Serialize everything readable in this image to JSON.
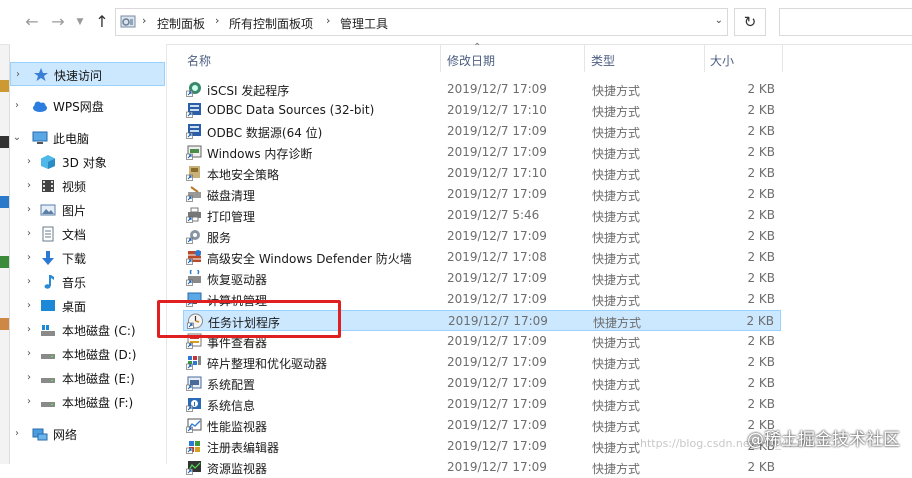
{
  "address_bar": {
    "breadcrumbs": [
      "控制面板",
      "所有控制面板项",
      "管理工具"
    ]
  },
  "sidebar": {
    "items": [
      {
        "label": "快速访问",
        "icon": "star-pin-icon",
        "selected": true
      },
      {
        "label": "WPS网盘",
        "icon": "cloud-icon"
      },
      {
        "label": "此电脑",
        "icon": "computer-icon",
        "expanded": true
      },
      {
        "label": "3D 对象",
        "icon": "cube-3d-icon"
      },
      {
        "label": "视频",
        "icon": "video-icon"
      },
      {
        "label": "图片",
        "icon": "picture-icon"
      },
      {
        "label": "文档",
        "icon": "document-icon"
      },
      {
        "label": "下载",
        "icon": "download-arrow-icon"
      },
      {
        "label": "音乐",
        "icon": "music-note-icon"
      },
      {
        "label": "桌面",
        "icon": "desktop-icon"
      },
      {
        "label": "本地磁盘 (C:)",
        "icon": "windows-drive-icon"
      },
      {
        "label": "本地磁盘 (D:)",
        "icon": "drive-icon"
      },
      {
        "label": "本地磁盘 (E:)",
        "icon": "drive-icon"
      },
      {
        "label": "本地磁盘 (F:)",
        "icon": "drive-icon"
      },
      {
        "label": "网络",
        "icon": "network-icon"
      }
    ]
  },
  "columns": {
    "name": "名称",
    "date": "修改日期",
    "type": "类型",
    "size": "大小"
  },
  "files": [
    {
      "name": "iSCSI 发起程序",
      "date": "2019/12/7 17:09",
      "type": "快捷方式",
      "size": "2 KB",
      "icon": "iscsi-icon"
    },
    {
      "name": "ODBC Data Sources (32-bit)",
      "date": "2019/12/7 17:10",
      "type": "快捷方式",
      "size": "2 KB",
      "icon": "odbc-icon"
    },
    {
      "name": "ODBC 数据源(64 位)",
      "date": "2019/12/7 17:09",
      "type": "快捷方式",
      "size": "2 KB",
      "icon": "odbc-icon"
    },
    {
      "name": "Windows 内存诊断",
      "date": "2019/12/7 17:09",
      "type": "快捷方式",
      "size": "2 KB",
      "icon": "memory-diagnostic-icon"
    },
    {
      "name": "本地安全策略",
      "date": "2019/12/7 17:10",
      "type": "快捷方式",
      "size": "2 KB",
      "icon": "security-policy-icon"
    },
    {
      "name": "磁盘清理",
      "date": "2019/12/7 17:09",
      "type": "快捷方式",
      "size": "2 KB",
      "icon": "disk-cleanup-icon"
    },
    {
      "name": "打印管理",
      "date": "2019/12/7 5:46",
      "type": "快捷方式",
      "size": "2 KB",
      "icon": "printer-icon"
    },
    {
      "name": "服务",
      "date": "2019/12/7 17:09",
      "type": "快捷方式",
      "size": "2 KB",
      "icon": "services-gear-icon"
    },
    {
      "name": "高级安全 Windows Defender 防火墙",
      "date": "2019/12/7 17:08",
      "type": "快捷方式",
      "size": "2 KB",
      "icon": "firewall-icon"
    },
    {
      "name": "恢复驱动器",
      "date": "2019/12/7 17:09",
      "type": "快捷方式",
      "size": "2 KB",
      "icon": "recovery-drive-icon"
    },
    {
      "name": "计算机管理",
      "date": "2019/12/7 17:09",
      "type": "快捷方式",
      "size": "2 KB",
      "icon": "computer-management-icon"
    },
    {
      "name": "任务计划程序",
      "date": "2019/12/7 17:09",
      "type": "快捷方式",
      "size": "2 KB",
      "icon": "task-scheduler-clock-icon",
      "selected": true
    },
    {
      "name": "事件查看器",
      "date": "2019/12/7 17:09",
      "type": "快捷方式",
      "size": "2 KB",
      "icon": "event-viewer-icon"
    },
    {
      "name": "碎片整理和优化驱动器",
      "date": "2019/12/7 17:09",
      "type": "快捷方式",
      "size": "2 KB",
      "icon": "defrag-icon"
    },
    {
      "name": "系统配置",
      "date": "2019/12/7 17:09",
      "type": "快捷方式",
      "size": "2 KB",
      "icon": "system-config-icon"
    },
    {
      "name": "系统信息",
      "date": "2019/12/7 17:09",
      "type": "快捷方式",
      "size": "2 KB",
      "icon": "system-info-icon"
    },
    {
      "name": "性能监视器",
      "date": "2019/12/7 17:09",
      "type": "快捷方式",
      "size": "2 KB",
      "icon": "performance-monitor-icon"
    },
    {
      "name": "注册表编辑器",
      "date": "2019/12/7 17:09",
      "type": "快捷方式",
      "size": "2 KB",
      "icon": "registry-editor-icon"
    },
    {
      "name": "资源监视器",
      "date": "2019/12/7 17:09",
      "type": "快捷方式",
      "size": "2 KB",
      "icon": "resource-monitor-icon"
    }
  ],
  "watermark": {
    "text": "@稀土掘金技术社区",
    "url": "https://blog.csdn.net/m0_47161"
  },
  "colors": {
    "selection_bg": "#cce8ff",
    "selection_border": "#99d1ff",
    "highlight_red": "#e02020",
    "header_text": "#4d6082"
  }
}
